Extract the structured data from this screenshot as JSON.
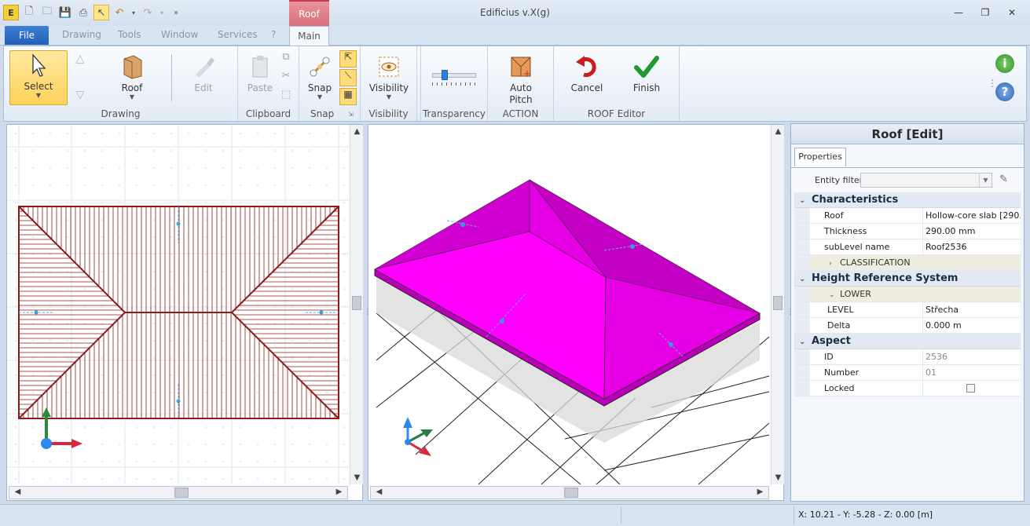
{
  "app": {
    "title": "Edificius v.X(g)",
    "context_tab": "Roof"
  },
  "menu": {
    "file": "File",
    "drawing": "Drawing",
    "tools": "Tools",
    "window": "Window",
    "services": "Services",
    "help": "?",
    "main": "Main"
  },
  "ribbon": {
    "drawing_group": "Drawing",
    "select": "Select",
    "roof": "Roof",
    "edit": "Edit",
    "clipboard_group": "Clipboard",
    "paste": "Paste",
    "snap_group": "Snap",
    "snap": "Snap",
    "visibility_group": "Visibility",
    "visibility": "Visibility",
    "transparency_group": "Transparency",
    "action_group": "ACTION",
    "auto_pitch_line1": "Auto",
    "auto_pitch_line2": "Pitch",
    "roof_editor_group": "ROOF Editor",
    "cancel": "Cancel",
    "finish": "Finish"
  },
  "panel": {
    "title": "Roof [Edit]",
    "tab": "Properties",
    "entity_filter": "Entity filter",
    "characteristics": "Characteristics",
    "roof_label": "Roof",
    "roof_value": "Hollow-core slab [290.00 mm",
    "thickness_label": "Thickness",
    "thickness_value": "290.00 mm",
    "sublevel_label": "subLevel name",
    "sublevel_value": "Roof2536",
    "classification": "CLASSIFICATION",
    "height_ref": "Height Reference System",
    "lower": "LOWER",
    "level_label": "LEVEL",
    "level_value": "Střecha",
    "delta_label": "Delta",
    "delta_value": "0.000 m",
    "aspect": "Aspect",
    "id_label": "ID",
    "id_value": "2536",
    "number_label": "Number",
    "number_value": "01",
    "locked_label": "Locked"
  },
  "status": {
    "coords": "X: 10.21 - Y: -5.28 - Z: 0.00 [m]"
  },
  "colors": {
    "roof_plan": "#8b1a1a",
    "roof_3d": "#ee00ee",
    "roof_3d_side": "#c800c8",
    "accent": "#1f5fb6"
  }
}
